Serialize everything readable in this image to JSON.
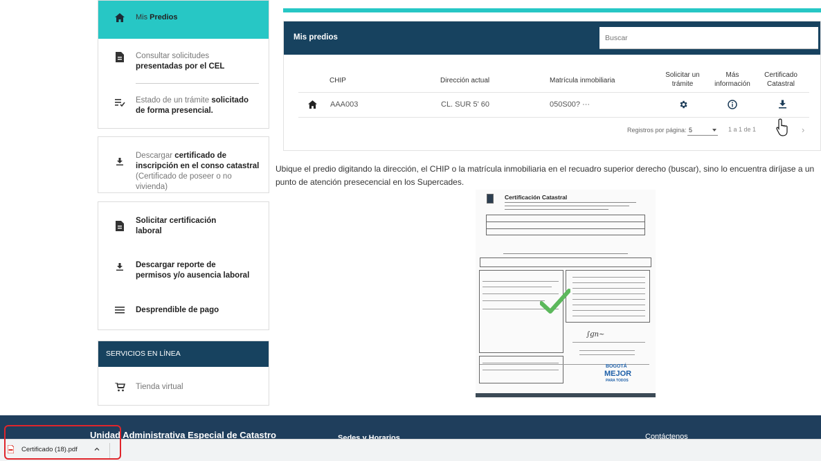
{
  "sidebar": {
    "mis_predios_light": "Mis ",
    "mis_predios_bold": "Predios",
    "consultar_light": "Consultar solicitudes ",
    "consultar_bold": "presentadas por el CEL",
    "estado_light": "Estado de un trámite ",
    "estado_bold": "solicitado de forma presencial.",
    "descargar_light1": "Descargar ",
    "descargar_bold": "certificado de inscripción en el conso catastral",
    "descargar_light2": " (Certificado de poseer o no vivienda)",
    "solicitar_cert": "Solicitar certificación laboral",
    "descargar_reporte": "Descargar reporte de permisos y/o ausencia laboral",
    "desprendible": "Desprendible de pago",
    "servicios_title": "SERVICIOS EN LÍNEA",
    "tienda": "Tienda virtual"
  },
  "predios": {
    "title": "Mis predios",
    "search_placeholder": "Buscar",
    "columns": {
      "chip": "CHIP",
      "direccion": "Dirección actual",
      "matricula": "Matrícula inmobiliaria",
      "solicitar": "Solicitar un trámite",
      "mas_info": "Más información",
      "certificado": "Certificado Catastral"
    },
    "row": {
      "chip": "AAA003",
      "direccion": "CL.  SUR 5'   60",
      "matricula": "050S00?   ···"
    },
    "pagination": {
      "label": "Registros por página:",
      "page_size": "5",
      "range": "1 a 1 de 1"
    }
  },
  "instructions": "Ubique el predio digitando la dirección, el CHIP o la matrícula inmobiliaria en el recuadro superior derecho (buscar), sino lo encuentra diríjase a un punto de atención presecencial en los Supercades.",
  "certificate_image": {
    "title": "Certificación Catastral",
    "mejor_line1": "BOGOTÁ",
    "mejor_line2": "MEJOR",
    "mejor_line3": "PARA TODOS"
  },
  "footer": {
    "org": "Unidad Administrativa Especial de Catastro",
    "sedes": "Sedes y Horarios",
    "contacto": "Contáctenos"
  },
  "download_bar": {
    "file": "Certificado (18).pdf"
  },
  "colors": {
    "teal": "#27c7c5",
    "navy": "#17425f",
    "highlight_red": "#e0252b"
  }
}
